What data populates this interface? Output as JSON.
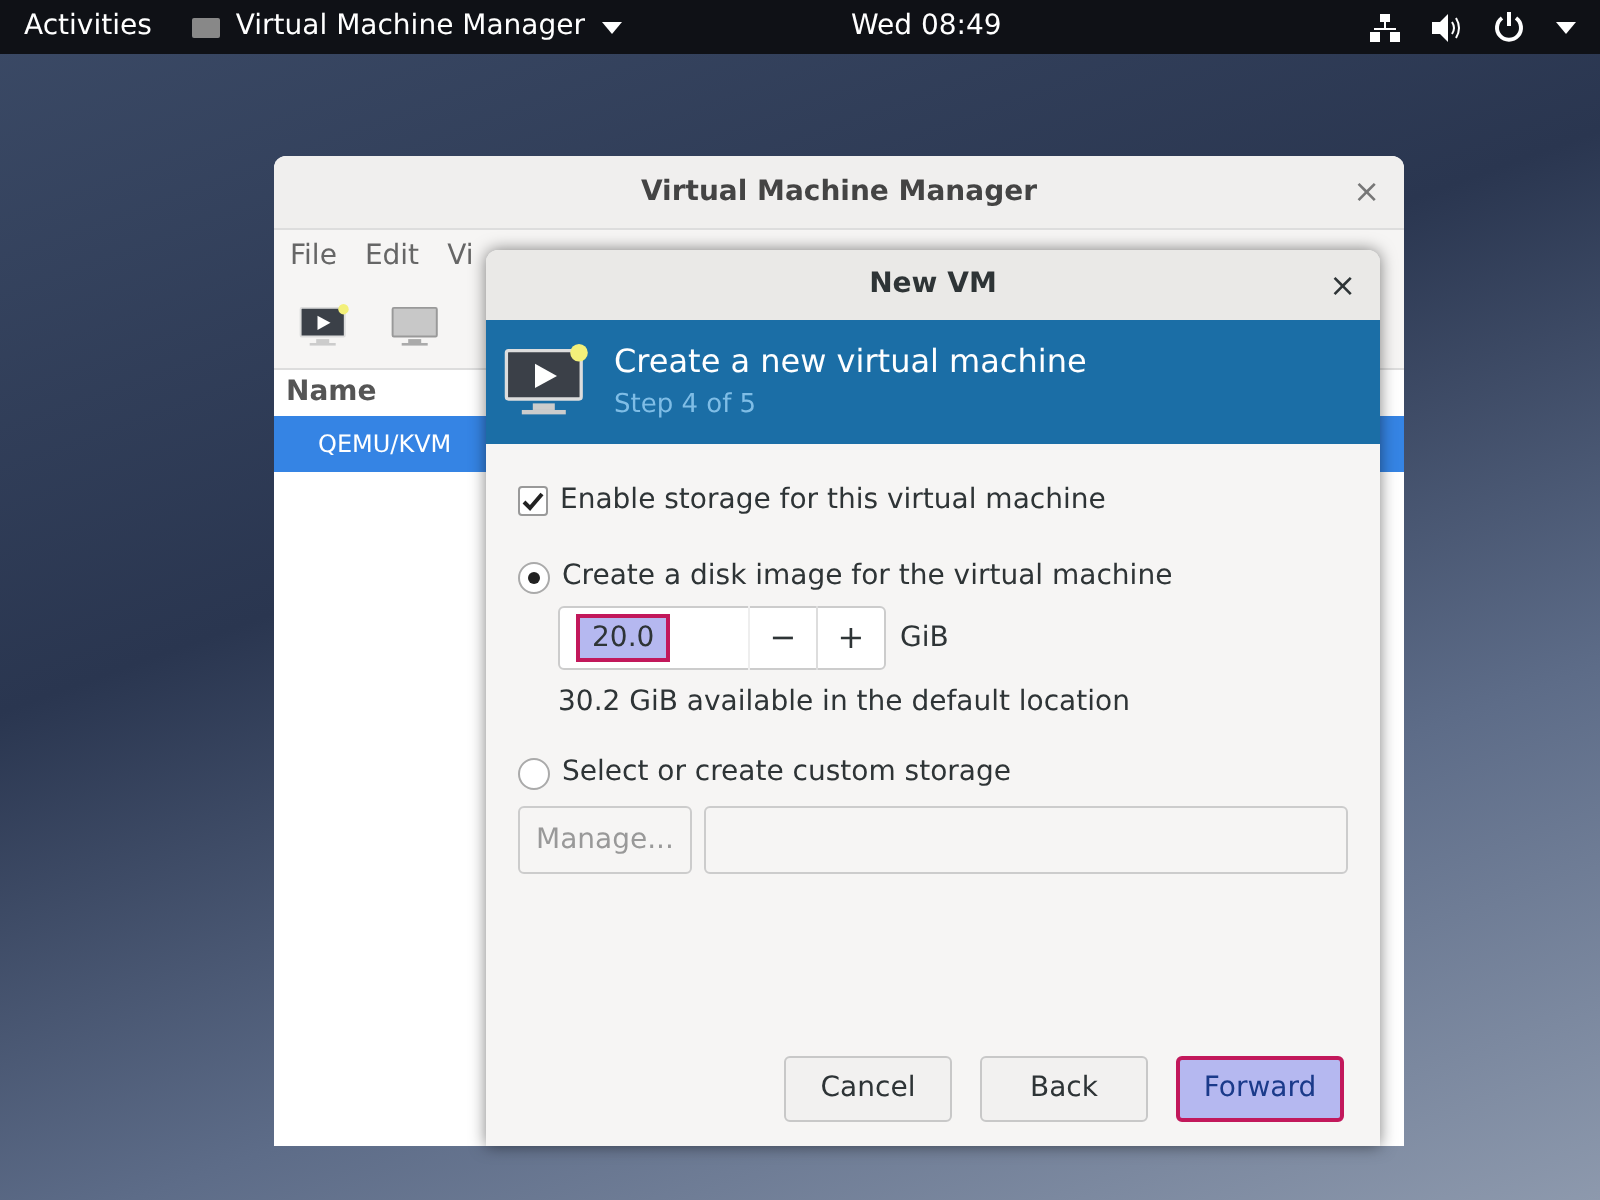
{
  "top_bar": {
    "activities": "Activities",
    "app_menu": "Virtual Machine Manager",
    "clock": "Wed 08:49"
  },
  "main_window": {
    "title": "Virtual Machine Manager",
    "close": "×",
    "menu": [
      "File",
      "Edit",
      "Vi"
    ],
    "column": "Name",
    "rows": [
      {
        "label": "QEMU/KVM",
        "selected": true
      }
    ]
  },
  "dialog": {
    "title": "New VM",
    "close": "×",
    "heading": "Create a new virtual machine",
    "step": "Step 4 of 5",
    "storage_checkbox": {
      "label": "Enable storage for this virtual machine",
      "checked": true
    },
    "options": [
      {
        "label": "Create a disk image for the virtual machine",
        "selected": true
      },
      {
        "label": "Select or create custom storage",
        "selected": false
      }
    ],
    "size": {
      "value": "20.0",
      "minus": "−",
      "plus": "+",
      "unit": "GiB",
      "highlighted": true
    },
    "available": "30.2 GiB available in the default location",
    "manage_button": {
      "label": "Manage...",
      "disabled": true
    },
    "buttons": [
      {
        "label": "Cancel",
        "highlighted": false
      },
      {
        "label": "Back",
        "highlighted": false
      },
      {
        "label": "Forward",
        "highlighted": true
      }
    ]
  }
}
